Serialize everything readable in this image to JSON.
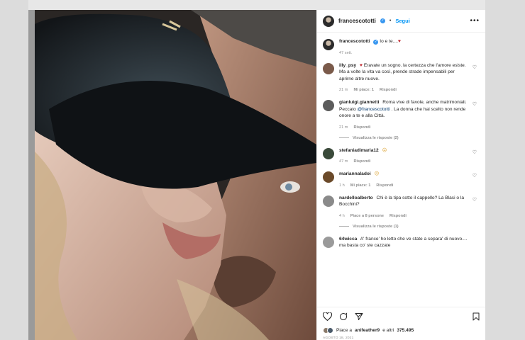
{
  "post": {
    "username": "francescototti",
    "follow_label": "Segui",
    "separator": "•",
    "more_label": "•••",
    "caption": "Io e te....",
    "caption_emoji": "♥",
    "caption_time": "47 sett."
  },
  "comments": [
    {
      "user": "illy_psy",
      "emoji": "♥",
      "text": "Eravate un sogno. la certezza che l'amore esiste. Ma a volte la vita va così, prende strade impensabili per aprirne altre nuove.",
      "time": "21 m",
      "likes": "Mi piace: 1",
      "reply": "Rispondi",
      "avatar_color": "#7a5a4a"
    },
    {
      "user": "gianluigi.giannetti",
      "text_before": "Roma vive di favole, anche matrimoniali. Peccato ",
      "mention": "@francescototti",
      "text_after": " . La donna che hai scelto non rende onore a te e alla Città.",
      "time": "21 m",
      "reply": "Rispondi",
      "view_replies": "Visualizza le risposte (2)",
      "avatar_color": "#5c5c5c"
    },
    {
      "user": "stefaniadimaria12",
      "emoji": "☹",
      "time": "47 m",
      "reply": "Rispondi",
      "avatar_color": "#3a4a3a"
    },
    {
      "user": "mariannaladoi",
      "emoji": "☹",
      "time": "1 h",
      "likes": "Mi piace: 1",
      "reply": "Rispondi",
      "avatar_color": "#6b4a2a"
    },
    {
      "user": "nardelloalberto",
      "text": "Chi è la tipa sotto il cappello? La Blasi o la Bocchini?",
      "time": "4 h",
      "likes": "Piace a 8 persone",
      "reply": "Rispondi",
      "view_replies": "Visualizza le risposte (1)",
      "avatar_color": "#8a8a8a"
    },
    {
      "user": "64wicca",
      "text": "A' france' ho letto che ve state a separa' di nuovo.... ma basta co' ste cazzate",
      "avatar_color": "#9a9a9a"
    }
  ],
  "likes": {
    "prefix": "Piace a",
    "user": "anifeather9",
    "middle": "e altri",
    "count": "375.495"
  },
  "date": "AGOSTO 18, 2021",
  "icons": {
    "like": "heart-icon",
    "comment": "comment-icon",
    "share": "share-icon",
    "save": "bookmark-icon",
    "options": "more-options-icon",
    "verified": "verified-badge-icon"
  },
  "colors": {
    "link_blue": "#0095f6",
    "text": "#262626",
    "muted": "#8e8e8e",
    "caption_heart": "#c0262d"
  }
}
